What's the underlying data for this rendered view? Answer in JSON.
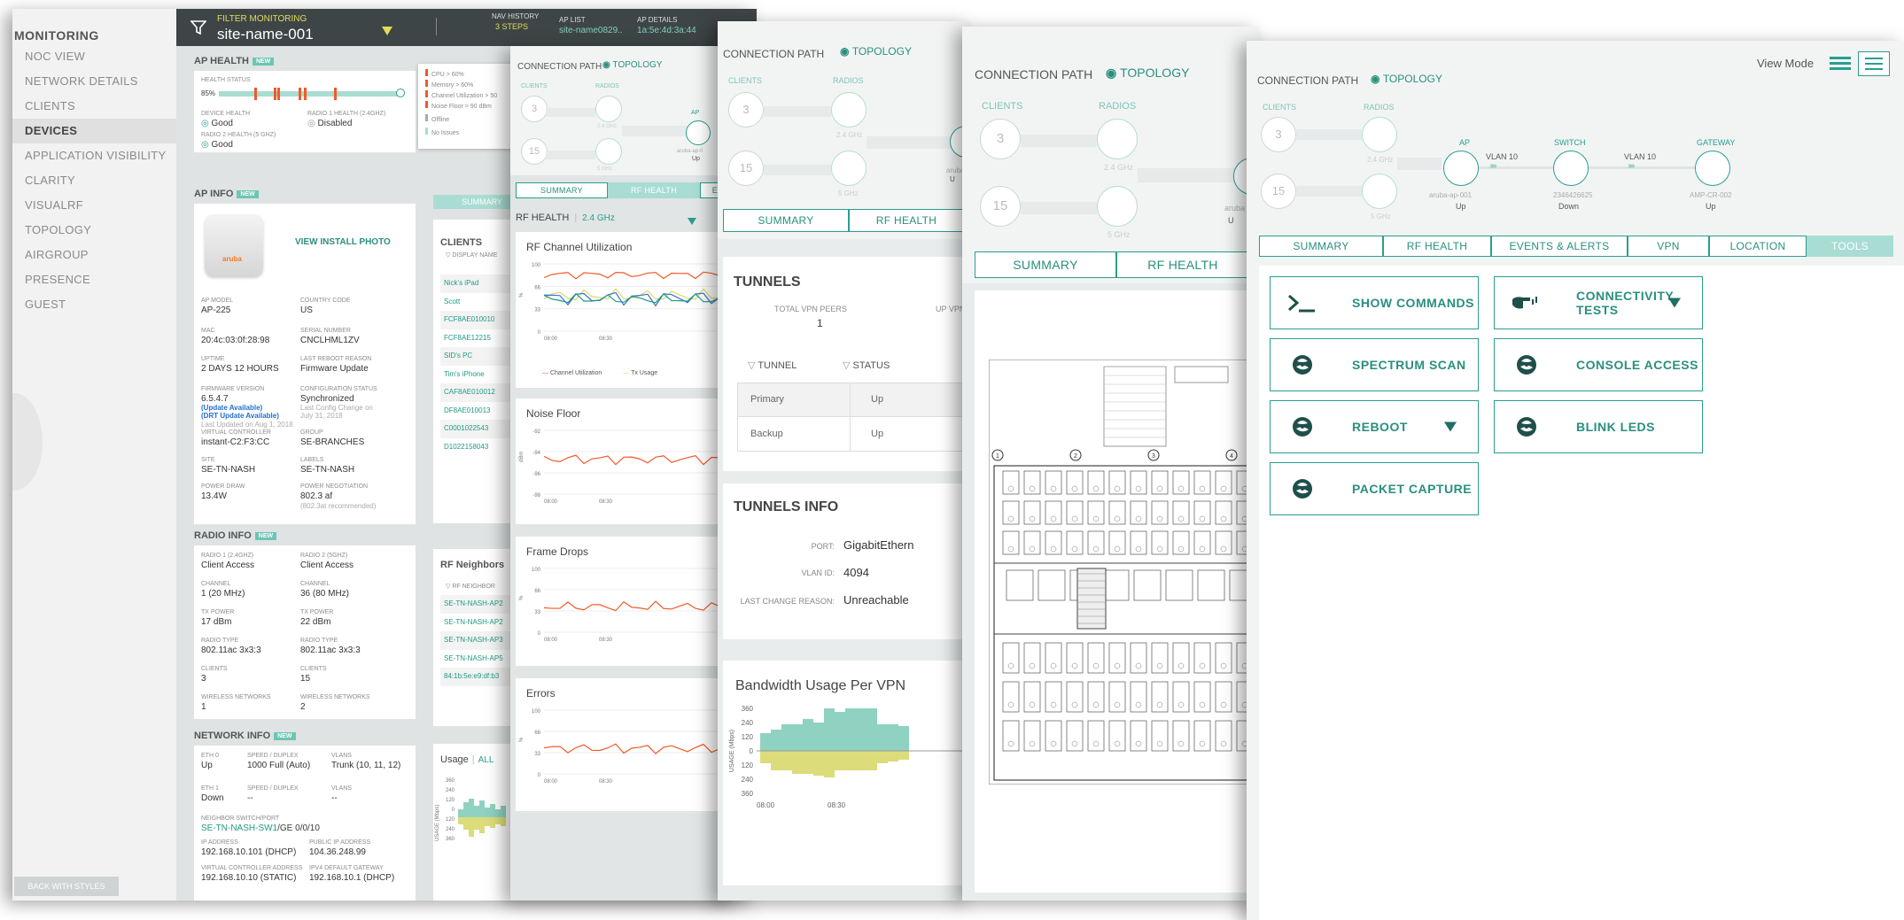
{
  "layer1": {
    "nav": {
      "header": "MONITORING",
      "items": [
        "NOC VIEW",
        "NETWORK DETAILS",
        "CLIENTS",
        "DEVICES",
        "APPLICATION VISIBILITY",
        "CLARITY",
        "VISUALRF",
        "TOPOLOGY",
        "AIRGROUP",
        "PRESENCE",
        "GUEST"
      ],
      "active_index": 3,
      "back_label": "BACK WITH STYLES"
    },
    "topbar": {
      "filter_label": "FILTER MONITORING",
      "site": "site-name-001",
      "nav_history_label": "NAV HISTORY",
      "nav_history_value": "3 STEPS",
      "ap_list_label": "AP LIST",
      "ap_list_value": "site-name0829..",
      "ap_details_label": "AP DETAILS",
      "ap_details_value": "1a:5e:4d:3a:44"
    },
    "ap_health": {
      "title": "AP HEALTH",
      "tag": "NEW",
      "status_label": "HEALTH STATUS",
      "status_value": "85%",
      "device_health_label": "DEVICE HEALTH",
      "device_health": "Good",
      "radio1_label": "RADIO 1 HEALTH (2.4GHz)",
      "radio1": "Disabled",
      "radio2_label": "RADIO 2 HEALTH (5 GHz)",
      "radio2": "Good",
      "tooltip": [
        "CPU > 60%",
        "Memory > 60%",
        "Channel Utilization > 50",
        "Noise Floor > 90 dBm",
        "Offline",
        "No Issues"
      ]
    },
    "ap_info": {
      "title": "AP INFO",
      "tag": "NEW",
      "install_photo": "VIEW INSTALL PHOTO",
      "brand": "aruba",
      "fields": [
        [
          "AP MODEL",
          "AP-225"
        ],
        [
          "COUNTRY CODE",
          "US"
        ],
        [
          "MAC",
          "20:4c:03:0f:28:98"
        ],
        [
          "SERIAL NUMBER",
          "CNCLHML1ZV"
        ],
        [
          "UPTIME",
          "2 DAYS 12 HOURS"
        ],
        [
          "LAST REBOOT REASON",
          "Firmware Update"
        ],
        [
          "FIRMWARE VERSION",
          "6.5.4.7"
        ],
        [
          "CONFIGURATION STATUS",
          "Synchronized"
        ],
        [
          "VIRTUAL CONTROLLER",
          "instant-C2:F3:CC"
        ],
        [
          "GROUP",
          "SE-BRANCHES"
        ],
        [
          "SITE",
          "SE-TN-NASH"
        ],
        [
          "LABELS",
          "SE-TN-NASH"
        ],
        [
          "POWER DRAW",
          "13.4W"
        ],
        [
          "POWER NEGOTIATION",
          "802.3 af"
        ]
      ],
      "firmware_notes": [
        "(Update Available)",
        "(DRT Update Available)",
        "Last Updated on Aug 1, 2018"
      ],
      "config_notes": [
        "Last Config Change on",
        "July 31, 2018"
      ],
      "power_note": "(802.3at recommended)"
    },
    "radio_info": {
      "title": "RADIO INFO",
      "tag": "NEW",
      "fields": [
        [
          "RADIO 1 (2.4GHZ)",
          "Client Access"
        ],
        [
          "RADIO 2 (5GHZ)",
          "Client Access"
        ],
        [
          "CHANNEL",
          "1 (20 MHz)"
        ],
        [
          "CHANNEL",
          "36 (80 MHz)"
        ],
        [
          "TX POWER",
          "17 dBm"
        ],
        [
          "TX POWER",
          "22 dBm"
        ],
        [
          "RADIO TYPE",
          "802.11ac 3x3:3"
        ],
        [
          "RADIO TYPE",
          "802.11ac 3x3:3"
        ],
        [
          "CLIENTS",
          "3"
        ],
        [
          "CLIENTS",
          "15"
        ],
        [
          "WIRELESS NETWORKS",
          "1"
        ],
        [
          "WIRELESS NETWORKS",
          "2"
        ]
      ]
    },
    "network_info": {
      "title": "NETWORK INFO",
      "tag": "NEW",
      "row1": [
        [
          "ETH 0",
          "Up"
        ],
        [
          "SPEED / DUPLEX",
          "1000 Full (Auto)"
        ],
        [
          "VLANS",
          "Trunk (10, 11, 12)"
        ]
      ],
      "row2": [
        [
          "ETH 1",
          "Down"
        ],
        [
          "SPEED / DUPLEX",
          "--"
        ],
        [
          "VLANS",
          "--"
        ]
      ],
      "neighbor_label": "NEIGHBOR SWITCH/PORT",
      "neighbor_switch": "SE-TN-NASH-SW1",
      "neighbor_port": "/GE 0/0/10",
      "ip_label": "IP ADDRESS",
      "ip": "192.168.10.101 (DHCP)",
      "pub_ip_label": "PUBLIC IP ADDRESS",
      "pub_ip": "104.36.248.99",
      "vc_label": "VIRTUAL CONTROLLER ADDRESS",
      "vc": "192.168.10.10 (STATIC)",
      "gw_label": "IPV4 DEFAULT GATEWAY",
      "gw": "192.168.10.1 (DHCP)"
    },
    "summary_tab": "SUMMARY",
    "clients": {
      "title": "CLIENTS",
      "col": "DISPLAY NAME",
      "rows": [
        "Nick's iPad",
        "Scott",
        "FCF8AE010010",
        "FCF8AE12215",
        "SID's PC",
        "Tim's iPhone",
        "CAF8AE010012",
        "DF8AE010013",
        "C0001022543",
        "D1022158043"
      ]
    },
    "rf_neighbors": {
      "title": "RF Neighbors",
      "col": "RF NEIGHBOR",
      "rows": [
        "SE-TN-NASH-AP2",
        "SE-TN-NASH-AP2",
        "SE-TN-NASH-AP3",
        "SE-TN-NASH-AP5",
        "84:1b:5e:e9:df:b3"
      ]
    },
    "usage": {
      "title": "Usage",
      "all": "ALL",
      "ylabel": "USAGE (Mbps)",
      "ticks": [
        "360",
        "240",
        "120",
        "0",
        "120",
        "240",
        "360"
      ]
    }
  },
  "layer2": {
    "conn_path": "CONNECTION PATH",
    "topology": "TOPOLOGY",
    "clients_cap": "CLIENTS",
    "radios_cap": "RADIOS",
    "ap_cap": "AP",
    "c1": "3",
    "c2": "15",
    "band1": "2.4 GHz",
    "band2": "5 GHz",
    "ap_name": "aruba-ap-0",
    "ap_status": "Up",
    "tabs": [
      "SUMMARY",
      "RF HEALTH",
      "EV"
    ],
    "rf_health": "RF HEALTH",
    "band_sel": "2.4 GHz",
    "charts": [
      {
        "title": "RF Channel Utilization",
        "ticks": [
          "100",
          "66",
          "33",
          "0"
        ],
        "x": [
          "08:00",
          "08:30"
        ],
        "legend": [
          "Channel Utilization",
          "Tx Usage"
        ]
      },
      {
        "title": "Noise Floor",
        "ticks": [
          "-92",
          "-94",
          "-96",
          "-98"
        ],
        "ylabel": "dBm",
        "x": [
          "08:00",
          "08:30"
        ]
      },
      {
        "title": "Frame Drops",
        "ticks": [
          "100",
          "66",
          "33",
          "0"
        ],
        "ylabel": "%",
        "x": [
          "08:00",
          "08:30"
        ]
      },
      {
        "title": "Errors",
        "ticks": [
          "100",
          "66",
          "33",
          "0"
        ],
        "ylabel": "%",
        "x": [
          "08:00",
          "08:30"
        ]
      }
    ],
    "util_ylabel": "%"
  },
  "layer3": {
    "conn_path": "CONNECTION PATH",
    "topology": "TOPOLOGY",
    "clients_cap": "CLIENTS",
    "radios_cap": "RADIOS",
    "c1": "3",
    "c2": "15",
    "band1": "2.4 GHz",
    "band2": "5 GHz",
    "ap_name": "aruba",
    "ap_status": "U",
    "tabs": [
      "SUMMARY",
      "RF HEALTH"
    ],
    "tunnels": {
      "title": "TUNNELS",
      "peers_label": "TOTAL VPN PEERS",
      "peers": "1",
      "vpn_label": "UP VPN",
      "col1": "TUNNEL",
      "col2": "STATUS",
      "rows": [
        [
          "Primary",
          "Up"
        ],
        [
          "Backup",
          "Up"
        ]
      ]
    },
    "tunnels_info": {
      "title": "TUNNELS INFO",
      "port_label": "PORT:",
      "port": "GigabitEthern",
      "vlan_label": "VLAN ID:",
      "vlan": "4094",
      "reason_label": "LAST CHANGE REASON:",
      "reason": "Unreachable"
    },
    "bandwidth": {
      "title": "Bandwidth Usage Per VPN",
      "ylabel": "USAGE (Mbps)",
      "ticks": [
        "360",
        "240",
        "120",
        "0",
        "120",
        "240",
        "360"
      ],
      "x": [
        "08:00",
        "08:30"
      ]
    }
  },
  "layer4": {
    "conn_path": "CONNECTION PATH",
    "topology": "TOPOLOGY",
    "clients_cap": "CLIENTS",
    "radios_cap": "RADIOS",
    "c1": "3",
    "c2": "15",
    "band1": "2.4 GHz",
    "band2": "5 GHz",
    "ap_name": "aruba",
    "ap_status": "U",
    "tabs": [
      "SUMMARY",
      "RF HEALTH"
    ],
    "floor_cols": [
      "1",
      "2",
      "3",
      "4"
    ]
  },
  "layer5": {
    "view_mode": "View Mode",
    "conn_path": "CONNECTION PATH",
    "topology": "TOPOLOGY",
    "clients_cap": "CLIENTS",
    "radios_cap": "RADIOS",
    "c1": "3",
    "c2": "15",
    "band1": "2.4 GHz",
    "band2": "5 GHz",
    "ap_cap": "AP",
    "ap_name": "aruba-ap-001",
    "ap_status": "Up",
    "vlan1": "VLAN 10",
    "switch_cap": "SWITCH",
    "switch_name": "2346426625",
    "switch_status": "Down",
    "vlan2": "VLAN 10",
    "gw_cap": "GATEWAY",
    "gw_name": "AMP-CR-002",
    "gw_status": "Up",
    "tabs": [
      "SUMMARY",
      "RF HEALTH",
      "EVENTS & ALERTS",
      "VPN",
      "LOCATION",
      "TOOLS"
    ],
    "active_tab": 5,
    "tools": [
      {
        "label": "SHOW COMMANDS",
        "icon": "terminal-icon",
        "dropdown": false
      },
      {
        "label": "CONNECTIVITY TESTS",
        "icon": "ping-icon",
        "dropdown": true
      },
      {
        "label": "SPECTRUM SCAN",
        "icon": "aruba-icon",
        "dropdown": false
      },
      {
        "label": "CONSOLE ACCESS",
        "icon": "aruba-icon",
        "dropdown": false
      },
      {
        "label": "REBOOT",
        "icon": "aruba-icon",
        "dropdown": true
      },
      {
        "label": "BLINK LEDs",
        "icon": "aruba-icon",
        "dropdown": false
      },
      {
        "label": "PACKET CAPTURE",
        "icon": "aruba-icon",
        "dropdown": false
      }
    ]
  },
  "colors": {
    "accent": "#2a9d8f",
    "accent_light": "#a9ddd3",
    "orange": "#f05a28",
    "yellow": "#d9d96a",
    "blue": "#3c6fd0",
    "dark": "#3e4546"
  }
}
